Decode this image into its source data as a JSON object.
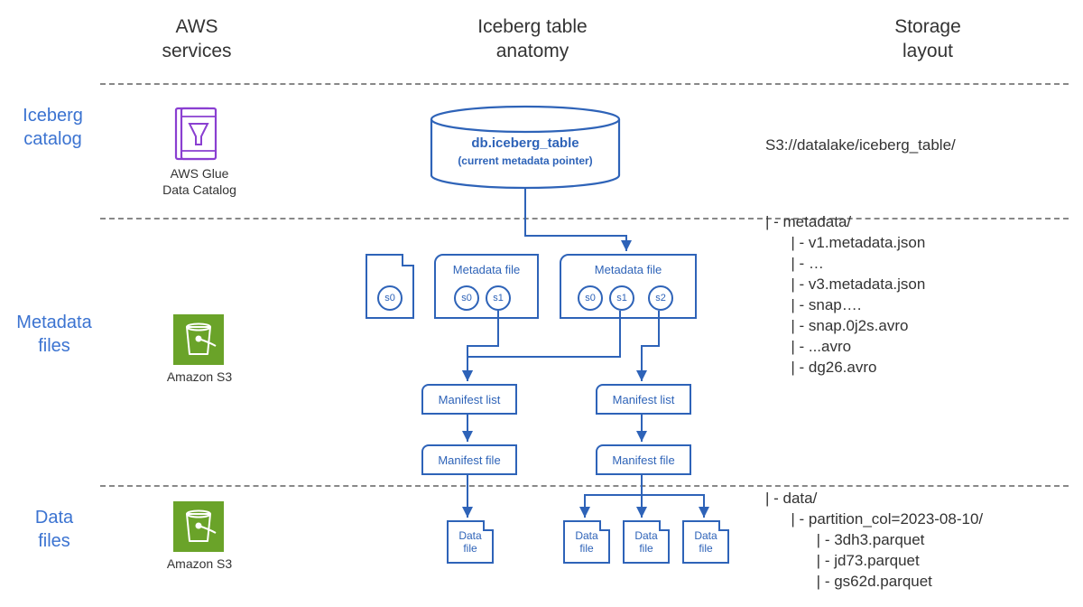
{
  "headers": {
    "col1_l1": "AWS",
    "col1_l2": "services",
    "col2_l1": "Iceberg table",
    "col2_l2": "anatomy",
    "col3_l1": "Storage",
    "col3_l2": "layout"
  },
  "rows": {
    "catalog_l1": "Iceberg",
    "catalog_l2": "catalog",
    "metadata_l1": "Metadata",
    "metadata_l2": "files",
    "data_l1": "Data",
    "data_l2": "files"
  },
  "services": {
    "glue_l1": "AWS Glue",
    "glue_l2": "Data Catalog",
    "s3": "Amazon S3"
  },
  "anatomy": {
    "catalog_title": "db.iceberg_table",
    "catalog_sub": "(current metadata pointer)",
    "metadata_file": "Metadata file",
    "snap_s0": "s0",
    "snap_s1": "s1",
    "snap_s2": "s2",
    "manifest_list": "Manifest list",
    "manifest_file": "Manifest file",
    "data_file": "Data\nfile"
  },
  "storage": {
    "catalog_path": "S3://datalake/iceberg_table/",
    "metadata_tree": "| - metadata/\n      | - v1.metadata.json\n      | - …\n      | - v3.metadata.json\n      | - snap….\n      | - snap.0j2s.avro\n      | - ...avro\n      | - dg26.avro",
    "data_tree": "| - data/\n      | - partition_col=2023-08-10/\n            | - 3dh3.parquet\n            | - jd73.parquet\n            | - gs62d.parquet"
  }
}
